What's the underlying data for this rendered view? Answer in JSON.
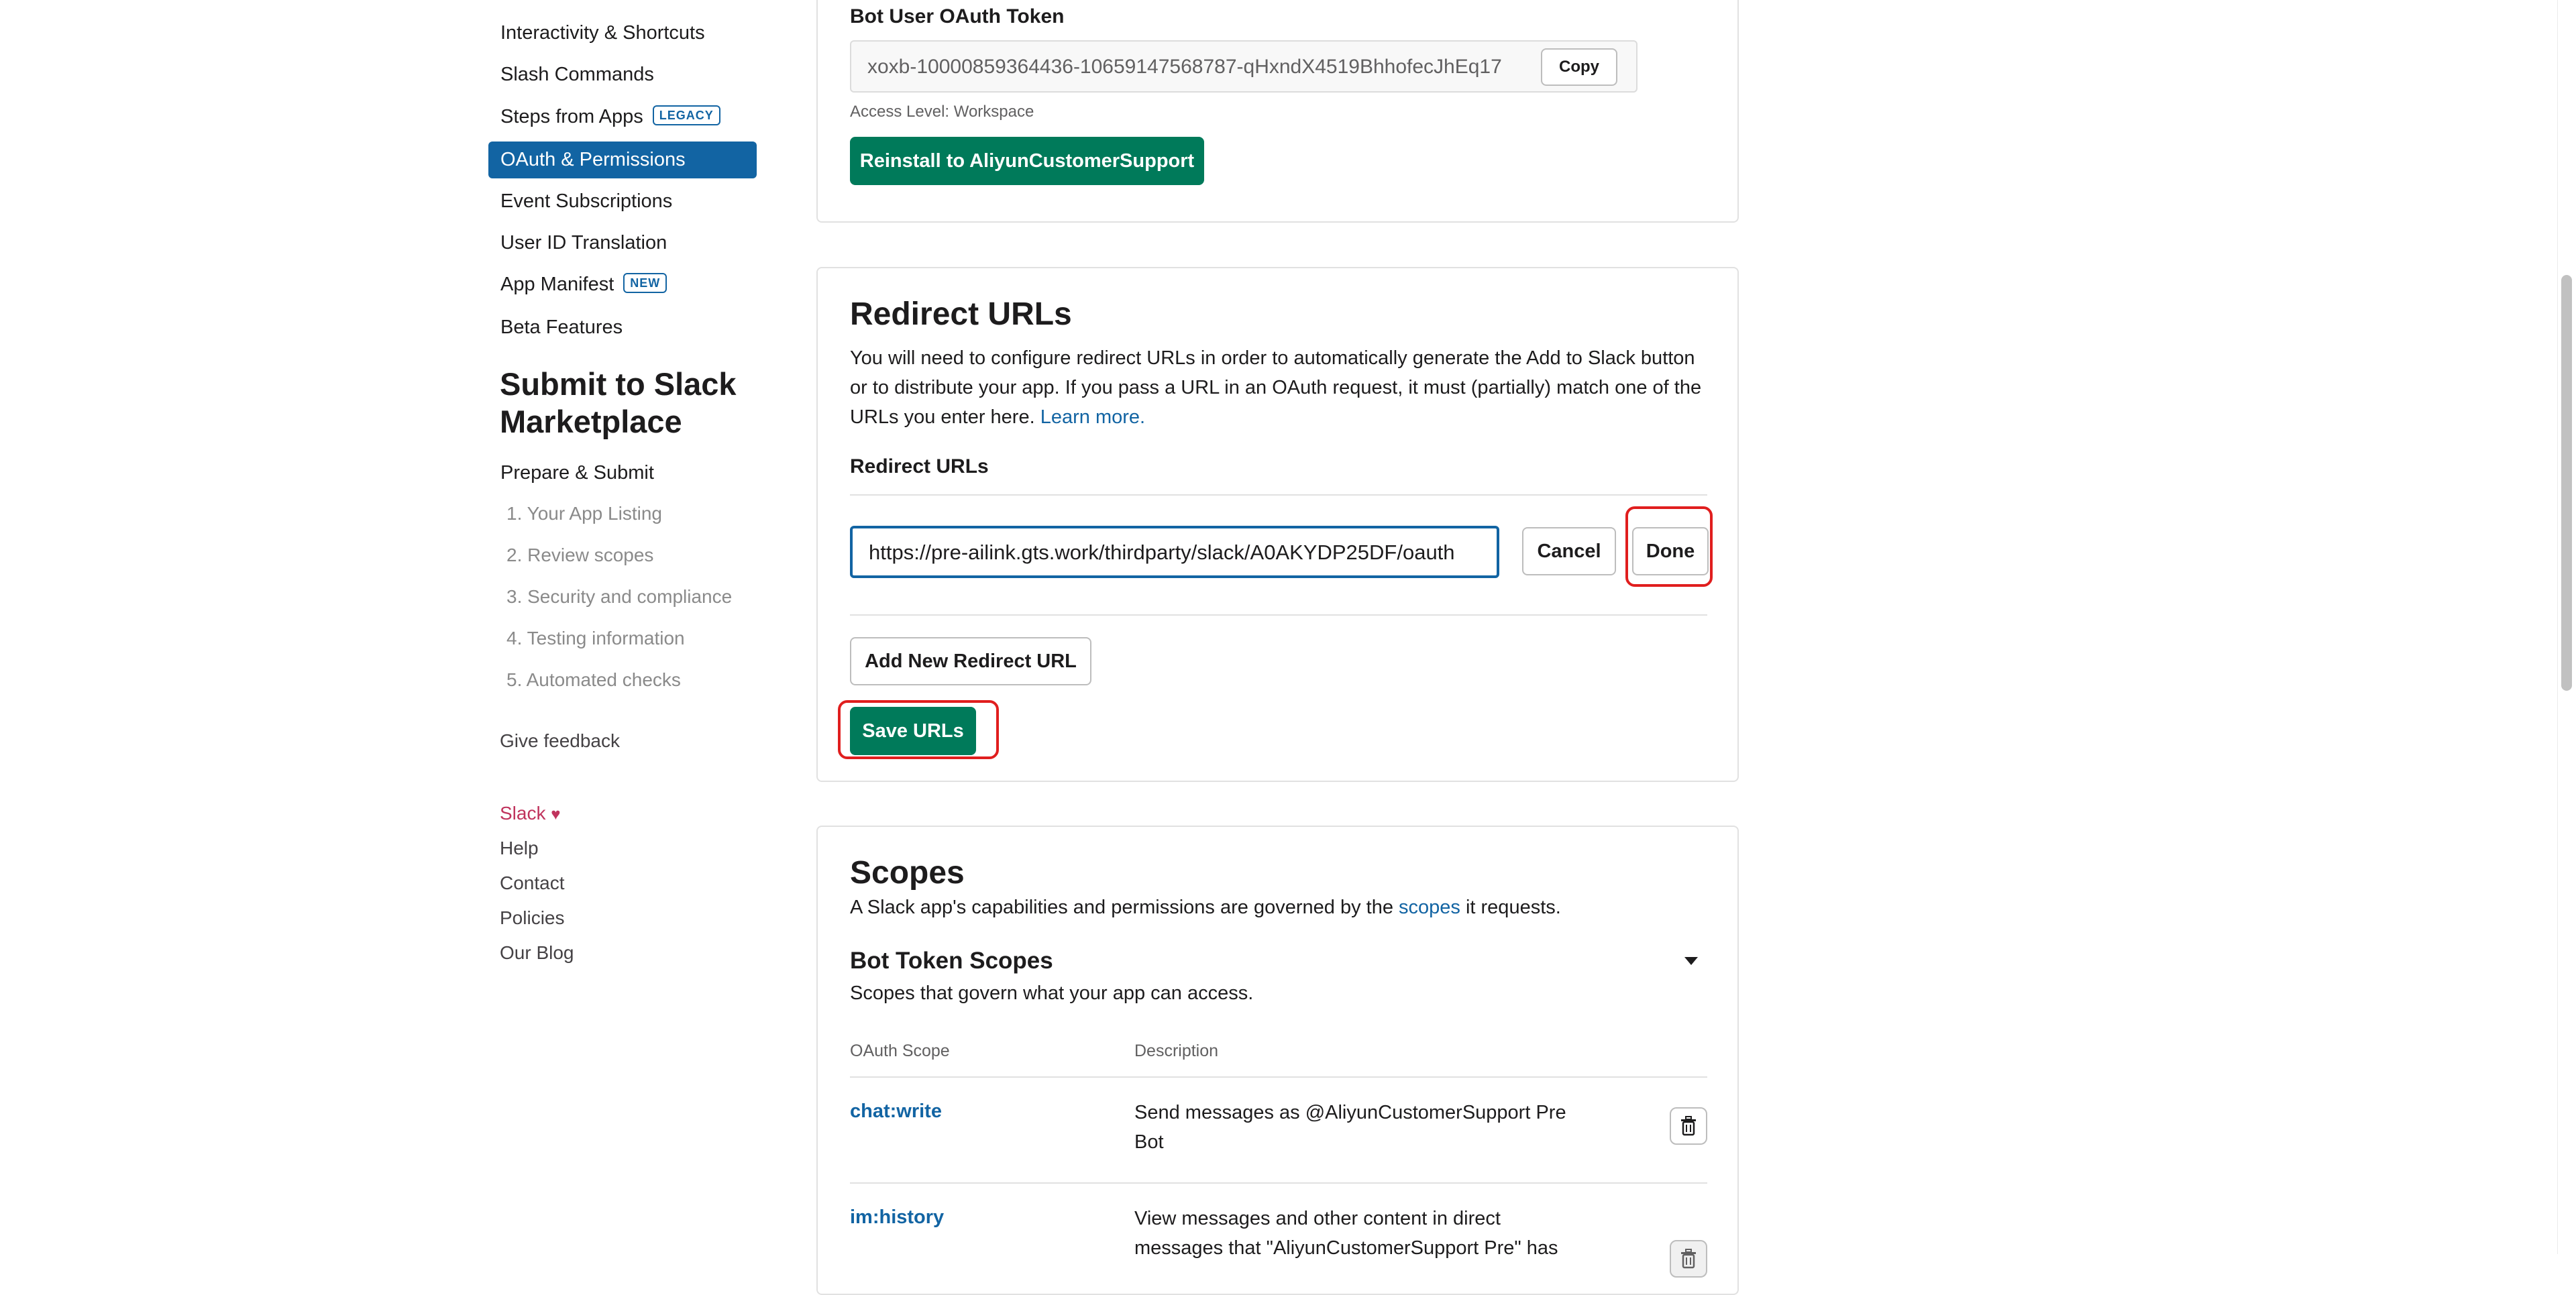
{
  "sidebar": {
    "items": [
      {
        "label": "Interactivity & Shortcuts"
      },
      {
        "label": "Slash Commands"
      },
      {
        "label": "Steps from Apps",
        "badge": "LEGACY"
      },
      {
        "label": "OAuth & Permissions"
      },
      {
        "label": "Event Subscriptions"
      },
      {
        "label": "User ID Translation"
      },
      {
        "label": "App Manifest",
        "badge": "NEW"
      },
      {
        "label": "Beta Features"
      }
    ],
    "marketplace_heading": "Submit to Slack Marketplace",
    "prepare_submit": "Prepare & Submit",
    "steps": [
      "1. Your App Listing",
      "2. Review scopes",
      "3. Security and compliance",
      "4. Testing information",
      "5. Automated checks"
    ],
    "give_feedback": "Give feedback",
    "footer": {
      "slack": "Slack",
      "heart": "♥",
      "help": "Help",
      "contact": "Contact",
      "policies": "Policies",
      "blog": "Our Blog"
    }
  },
  "token_card": {
    "label": "Bot User OAuth Token",
    "token_value": "xoxb-10000859364436-10659147568787-qHxndX4519BhhofecJhEq17",
    "copy_label": "Copy",
    "access_level": "Access Level: Workspace",
    "reinstall_label": "Reinstall to AliyunCustomerSupport"
  },
  "redirect_card": {
    "title": "Redirect URLs",
    "description": "You will need to configure redirect URLs in order to automatically generate the Add to Slack button or to distribute your app. If you pass a URL in an OAuth request, it must (partially) match one of the URLs you enter here.",
    "learn_more": "Learn more.",
    "subheading": "Redirect URLs",
    "url_value": "https://pre-ailink.gts.work/thirdparty/slack/A0AKYDP25DF/oauth",
    "cancel_label": "Cancel",
    "done_label": "Done",
    "add_new_label": "Add New Redirect URL",
    "save_label": "Save URLs"
  },
  "scopes_card": {
    "title": "Scopes",
    "description_pre": "A Slack app's capabilities and permissions are governed by the",
    "description_link": "scopes",
    "description_post": "it requests.",
    "bot_title": "Bot Token Scopes",
    "bot_subtitle": "Scopes that govern what your app can access.",
    "col_scope": "OAuth Scope",
    "col_description": "Description",
    "rows": [
      {
        "scope": "chat:write",
        "description": "Send messages as @AliyunCustomerSupport Pre Bot"
      },
      {
        "scope": "im:history",
        "description": "View messages and other content in direct messages that \"AliyunCustomerSupport Pre\" has"
      }
    ]
  },
  "colors": {
    "accent": "#1264a3",
    "green": "#007a5a",
    "highlight": "#e01e1e",
    "slack_pink": "#c0335d"
  }
}
